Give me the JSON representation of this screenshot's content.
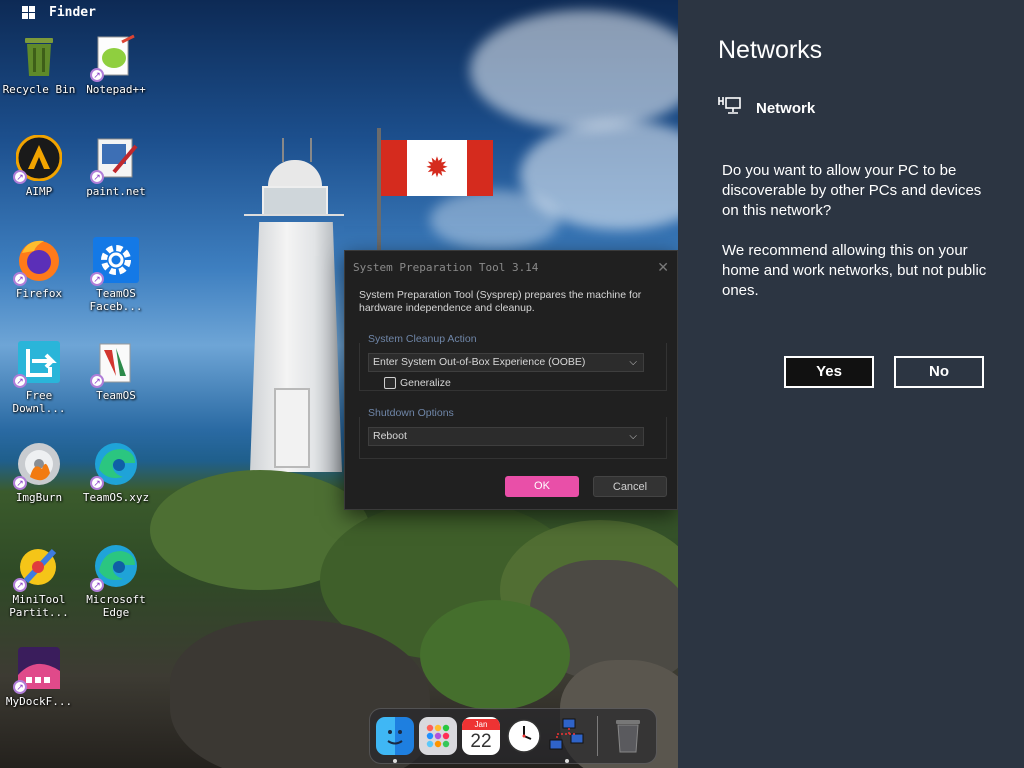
{
  "topbar": {
    "app_name": "Finder"
  },
  "desktop_icons": [
    {
      "label": "Recycle Bin",
      "icon": "recycle-bin-icon"
    },
    {
      "label": "Notepad++",
      "icon": "notepad-plus-plus-icon"
    },
    {
      "label": "AIMP",
      "icon": "aimp-icon"
    },
    {
      "label": "paint.net",
      "icon": "paint-net-icon"
    },
    {
      "label": "Firefox",
      "icon": "firefox-icon"
    },
    {
      "label": "TeamOS Faceb...",
      "icon": "settings-gear-icon"
    },
    {
      "label": "Free Downl...",
      "icon": "free-download-icon"
    },
    {
      "label": "TeamOS",
      "icon": "teamos-icon"
    },
    {
      "label": "ImgBurn",
      "icon": "imgburn-icon"
    },
    {
      "label": "TeamOS.xyz",
      "icon": "edge-icon"
    },
    {
      "label": "MiniTool Partit...",
      "icon": "minitool-icon"
    },
    {
      "label": "Microsoft Edge",
      "icon": "edge-icon"
    },
    {
      "label": "MyDockF...",
      "icon": "mydock-icon"
    }
  ],
  "sysprep": {
    "title": "System Preparation Tool 3.14",
    "description": "System Preparation Tool (Sysprep) prepares the machine for hardware independence and cleanup.",
    "cleanup_group": "System Cleanup Action",
    "cleanup_value": "Enter System Out-of-Box Experience (OOBE)",
    "generalize_label": "Generalize",
    "shutdown_group": "Shutdown Options",
    "shutdown_value": "Reboot",
    "ok_label": "OK",
    "cancel_label": "Cancel"
  },
  "networks": {
    "title": "Networks",
    "network_name": "Network",
    "question": "Do you want to allow your PC to be discoverable by other PCs and devices on this network?",
    "recommendation": "We recommend allowing this on your home and work networks, but not public ones.",
    "yes_label": "Yes",
    "no_label": "No"
  },
  "dock": {
    "calendar_month": "Jan",
    "calendar_day": "22",
    "items": [
      "finder-icon",
      "launchpad-icon",
      "calendar-icon",
      "clock-icon",
      "network-icon",
      "trash-icon"
    ]
  },
  "colors": {
    "accent_ok": "#e94fa8",
    "panel_bg": "#2c3542",
    "dialog_bg": "#202020"
  }
}
